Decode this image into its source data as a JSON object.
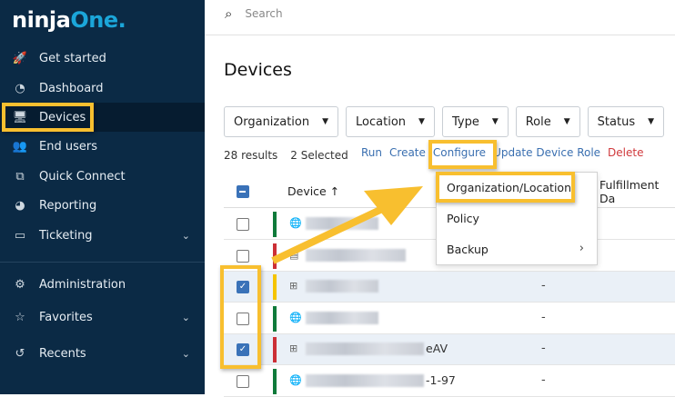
{
  "brand": {
    "logo_a": "ninja",
    "logo_b": "One."
  },
  "sidebar": {
    "items": [
      {
        "label": "Get started",
        "icon": "rocket-icon",
        "glyph": "🚀"
      },
      {
        "label": "Dashboard",
        "icon": "gauge-icon",
        "glyph": "◔"
      },
      {
        "label": "Devices",
        "icon": "devices-icon",
        "glyph": "🖥"
      },
      {
        "label": "End users",
        "icon": "users-icon",
        "glyph": "👥"
      },
      {
        "label": "Quick Connect",
        "icon": "quick-connect-icon",
        "glyph": "⧉"
      },
      {
        "label": "Reporting",
        "icon": "pie-chart-icon",
        "glyph": "◕"
      },
      {
        "label": "Ticketing",
        "icon": "ticket-icon",
        "glyph": "▭"
      },
      {
        "label": "Administration",
        "icon": "gear-icon",
        "glyph": "⚙"
      },
      {
        "label": "Favorites",
        "icon": "star-icon",
        "glyph": "☆"
      },
      {
        "label": "Recents",
        "icon": "history-icon",
        "glyph": "↺"
      }
    ]
  },
  "search": {
    "placeholder": "Search"
  },
  "page": {
    "title": "Devices"
  },
  "filters": [
    "Organization",
    "Location",
    "Type",
    "Role",
    "Status"
  ],
  "summary": {
    "results": "28 results",
    "selected": "2 Selected"
  },
  "actions": {
    "run": "Run",
    "create": "Create",
    "configure": "Configure",
    "update_role": "Update Device Role",
    "delete": "Delete"
  },
  "table": {
    "col_device": "Device ↑",
    "col_fulfillment": "Fulfillment Da",
    "rows": [
      {
        "status": "#0f7a3a",
        "os": "globe",
        "checked": false,
        "suffix": "",
        "value": ""
      },
      {
        "status": "#cc2f36",
        "os": "server",
        "checked": false,
        "suffix": "",
        "value": ""
      },
      {
        "status": "#f5c400",
        "os": "windows",
        "checked": true,
        "suffix": "",
        "value": "-"
      },
      {
        "status": "#0f7a3a",
        "os": "globe",
        "checked": false,
        "suffix": "",
        "value": "-"
      },
      {
        "status": "#cc2f36",
        "os": "windows",
        "checked": true,
        "suffix": "eAV",
        "value": "-"
      },
      {
        "status": "#0f7a3a",
        "os": "globe",
        "checked": false,
        "suffix": "-1-97",
        "value": "-"
      }
    ]
  },
  "configure_menu": {
    "items": [
      "Organization/Location",
      "Policy",
      "Backup"
    ]
  },
  "colors": {
    "sidebar": "#0b2a45",
    "accent": "#1ba6d9",
    "highlight": "#f8bf2f",
    "link": "#3a6fb0",
    "danger": "#d0393c"
  }
}
